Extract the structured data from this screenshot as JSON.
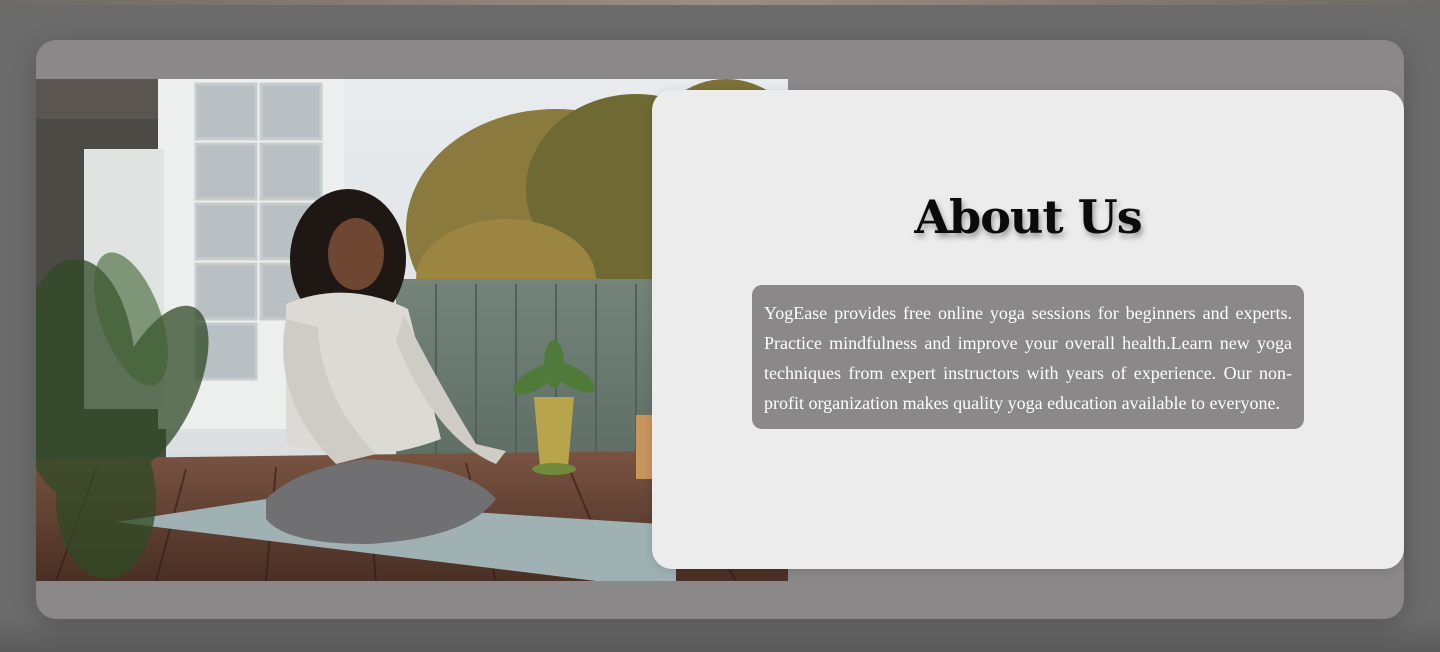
{
  "about": {
    "title": "About Us",
    "description": "YogEase provides free online yoga sessions for beginners and experts. Practice mindfulness and improve your overall health.Learn new yoga techniques from expert instructors with years of experience. Our non-profit organization makes quality yoga education available to everyone."
  },
  "colors": {
    "page_background": "#6b6b6b",
    "section_background": "#8a8889",
    "card_background": "#ececec",
    "title_text": "#0b0b0b",
    "description_text": "#ffffff"
  }
}
